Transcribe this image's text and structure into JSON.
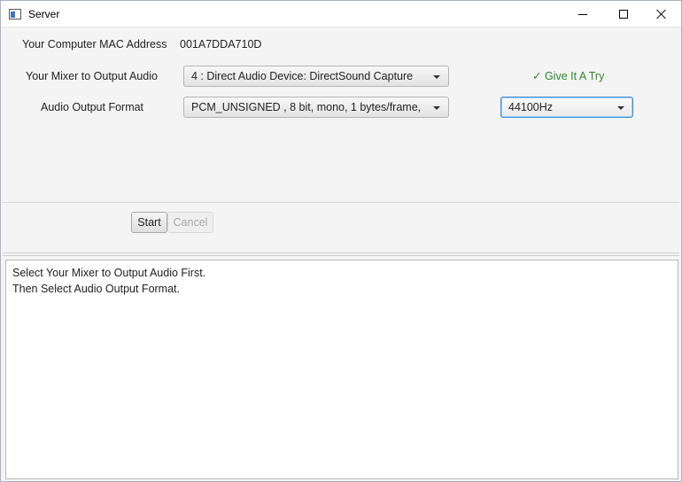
{
  "window": {
    "title": "Server"
  },
  "form": {
    "mac_label": "Your Computer MAC Address",
    "mac_value": "001A7DDA710D",
    "mixer_label": "Your Mixer to Output Audio",
    "mixer_selected": "4 : Direct Audio Device: DirectSound Capture",
    "format_label": "Audio Output Format",
    "format_selected": "PCM_UNSIGNED , 8 bit, mono, 1 bytes/frame,",
    "rate_selected": "44100Hz",
    "try_label": "✓ Give It A Try",
    "try_color": "#2a8a2a"
  },
  "actions": {
    "start_label": "Start",
    "cancel_label": "Cancel"
  },
  "log": {
    "lines": [
      "Select Your Mixer to Output Audio First.",
      "Then Select Audio Output Format."
    ]
  }
}
